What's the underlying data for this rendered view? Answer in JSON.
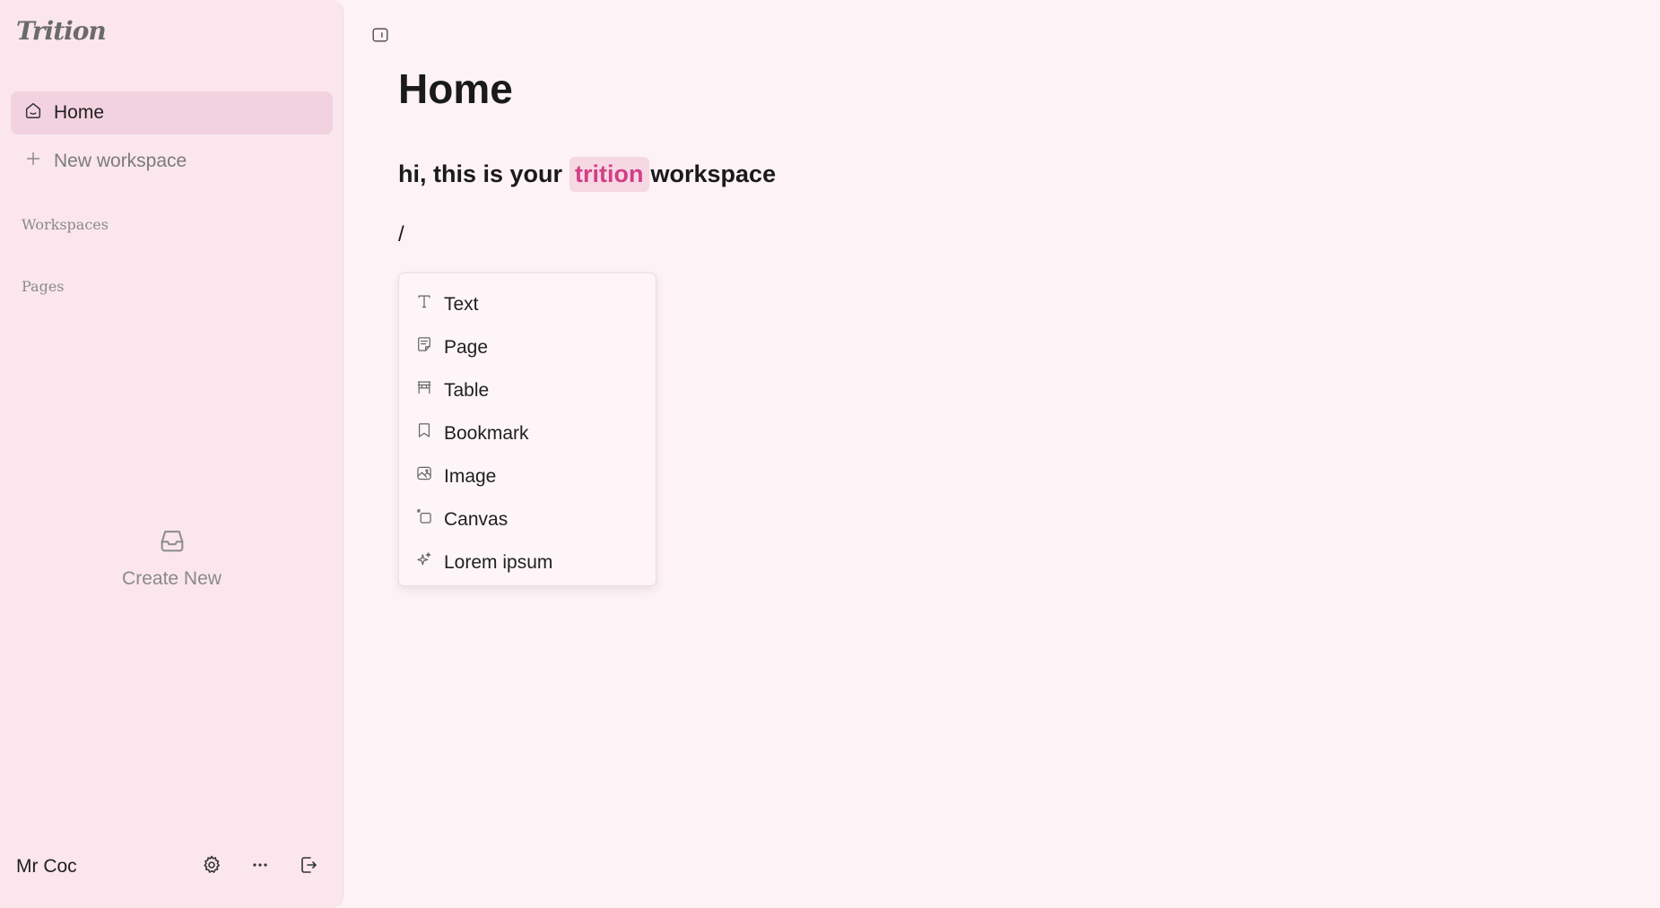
{
  "app": {
    "logo": "Trition"
  },
  "sidebar": {
    "home_label": "Home",
    "new_workspace_label": "New workspace",
    "workspaces_label": "Workspaces",
    "pages_label": "Pages",
    "create_new_label": "Create New",
    "user_name": "Mr Coc",
    "icons": {
      "home": "home-icon",
      "plus": "plus-icon",
      "inbox": "inbox-icon",
      "settings": "gear-icon",
      "more": "more-icon",
      "logout": "logout-icon"
    }
  },
  "main": {
    "title": "Home",
    "intro_prefix": "hi, this is your",
    "intro_highlight": "trition",
    "intro_suffix": "workspace",
    "slash": "/",
    "menu_items": [
      {
        "label": "Text",
        "icon": "text-icon"
      },
      {
        "label": "Page",
        "icon": "page-icon"
      },
      {
        "label": "Table",
        "icon": "table-icon"
      },
      {
        "label": "Bookmark",
        "icon": "bookmark-icon"
      },
      {
        "label": "Image",
        "icon": "image-icon"
      },
      {
        "label": "Canvas",
        "icon": "canvas-icon"
      },
      {
        "label": "Lorem ipsum",
        "icon": "sparkle-icon"
      }
    ]
  },
  "colors": {
    "background": "#fdf2f5",
    "sidebar": "#fbe6ee",
    "active_item": "#f3d2df",
    "highlight_bg": "#f6d8e3",
    "highlight_text": "#d23f86"
  }
}
